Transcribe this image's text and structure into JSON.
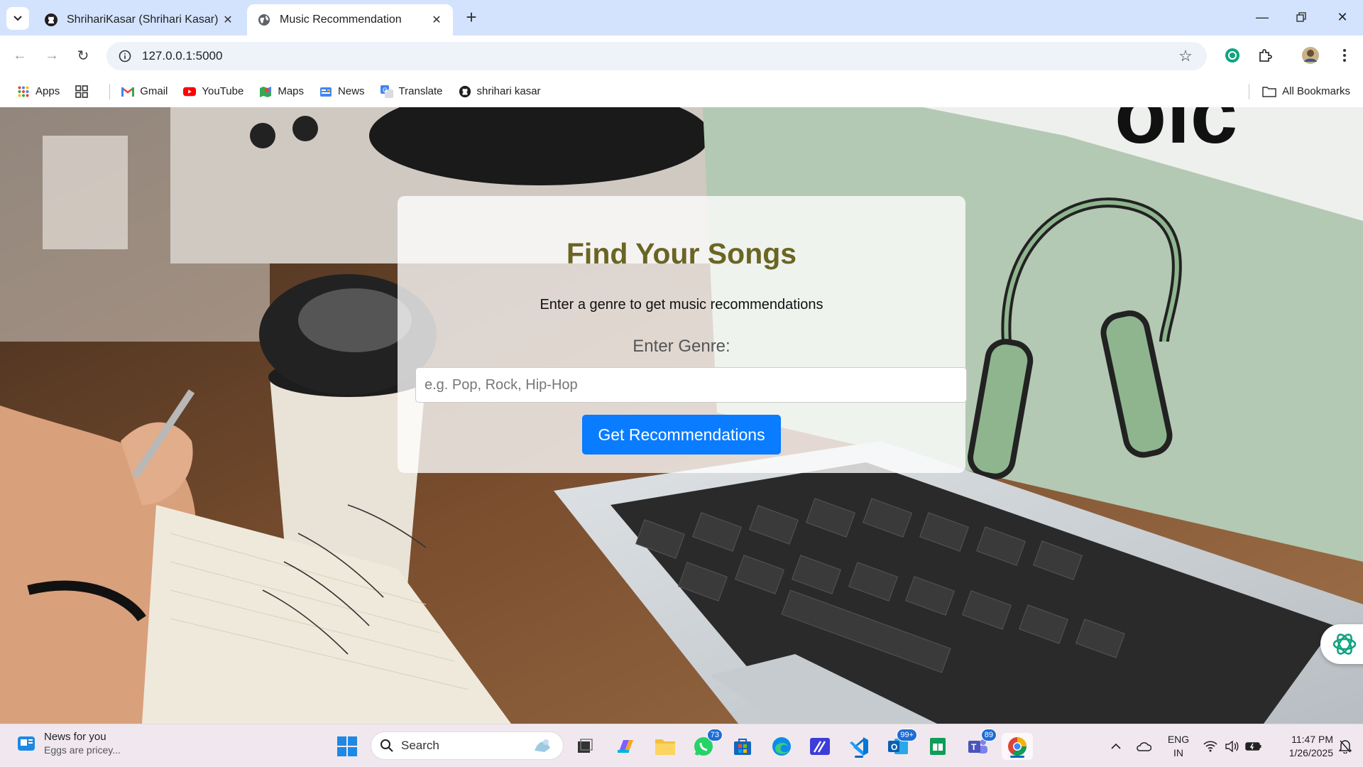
{
  "browser": {
    "tabs": [
      {
        "title": "ShrihariKasar (Shrihari Kasar)",
        "icon": "github-icon",
        "active": false
      },
      {
        "title": "Music Recommendation",
        "icon": "globe-icon",
        "active": true
      }
    ],
    "url": "127.0.0.1:5000",
    "bookmarks": [
      {
        "label": "Apps",
        "icon": "apps-grid-icon"
      },
      {
        "label": "",
        "icon": "tab-groups-icon"
      },
      {
        "label": "Gmail",
        "icon": "gmail-icon"
      },
      {
        "label": "YouTube",
        "icon": "youtube-icon"
      },
      {
        "label": "Maps",
        "icon": "maps-icon"
      },
      {
        "label": "News",
        "icon": "news-icon"
      },
      {
        "label": "Translate",
        "icon": "translate-icon"
      },
      {
        "label": "shrihari kasar",
        "icon": "github-icon"
      }
    ],
    "all_bookmarks": "All Bookmarks"
  },
  "page": {
    "title": "Find Your Songs",
    "subtitle": "Enter a genre to get music recommendations",
    "genre_label": "Enter Genre:",
    "genre_placeholder": "e.g. Pop, Rock, Hip-Hop",
    "genre_value": "",
    "submit_label": "Get Recommendations",
    "colors": {
      "title": "#6b6524",
      "button": "#0a7cff"
    }
  },
  "taskbar": {
    "news_title": "News for you",
    "news_subtitle": "Eggs are pricey...",
    "search_label": "Search",
    "badges": {
      "whatsapp": "73",
      "outlook": "99+",
      "teams": "89"
    },
    "language_top": "ENG",
    "language_bottom": "IN",
    "time": "11:47 PM",
    "date": "1/26/2025"
  }
}
